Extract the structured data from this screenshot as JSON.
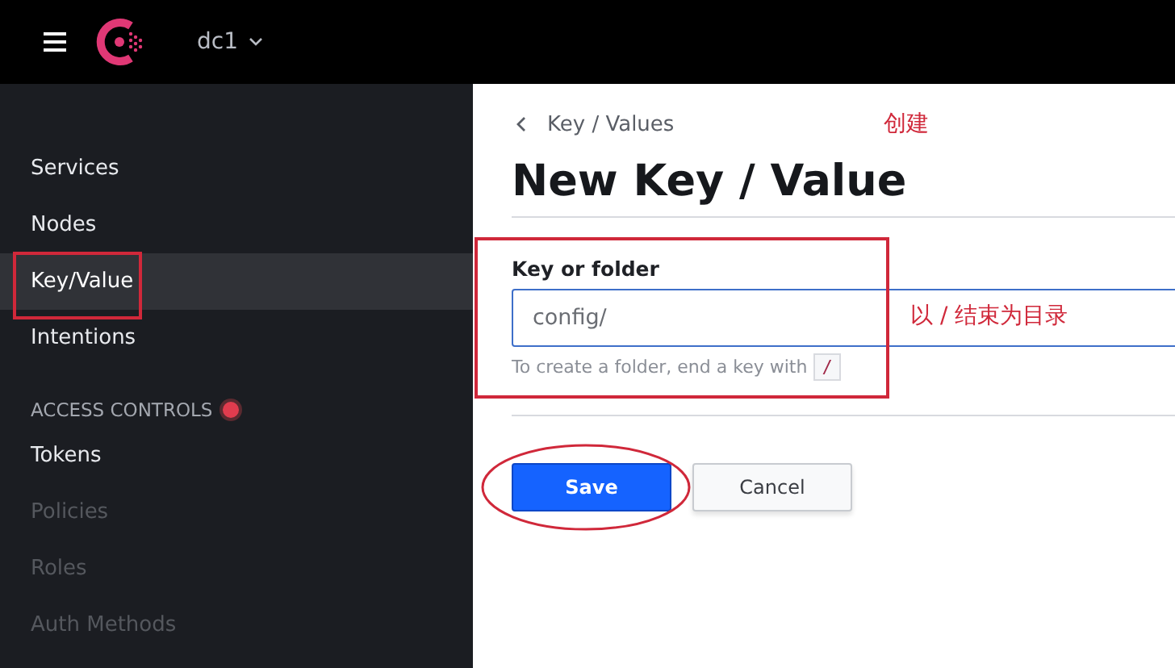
{
  "header": {
    "datacenter": "dc1"
  },
  "sidebar": {
    "items": [
      {
        "label": "Services",
        "selected": false,
        "disabled": false,
        "annotated": false
      },
      {
        "label": "Nodes",
        "selected": false,
        "disabled": false,
        "annotated": false
      },
      {
        "label": "Key/Value",
        "selected": true,
        "disabled": false,
        "annotated": true
      },
      {
        "label": "Intentions",
        "selected": false,
        "disabled": false,
        "annotated": false
      }
    ],
    "sections": [
      {
        "heading": "ACCESS CONTROLS",
        "alert": true,
        "items": [
          {
            "label": "Tokens",
            "selected": false,
            "disabled": false,
            "annotated": false
          },
          {
            "label": "Policies",
            "selected": false,
            "disabled": true,
            "annotated": false
          },
          {
            "label": "Roles",
            "selected": false,
            "disabled": true,
            "annotated": false
          },
          {
            "label": "Auth Methods",
            "selected": false,
            "disabled": true,
            "annotated": false
          }
        ]
      }
    ]
  },
  "main": {
    "breadcrumb": "Key / Values",
    "breadcrumb_annotation": "创建",
    "title": "New Key / Value",
    "field": {
      "label": "Key or folder",
      "value": "config/",
      "annotation": "以 / 结束为目录",
      "annotated": true,
      "hint": "To create a folder, end a key with",
      "hint_code": "/"
    },
    "buttons": [
      {
        "label": "Save",
        "kind": "primary",
        "annotated": true
      },
      {
        "label": "Cancel",
        "kind": "secondary",
        "annotated": false
      }
    ]
  }
}
